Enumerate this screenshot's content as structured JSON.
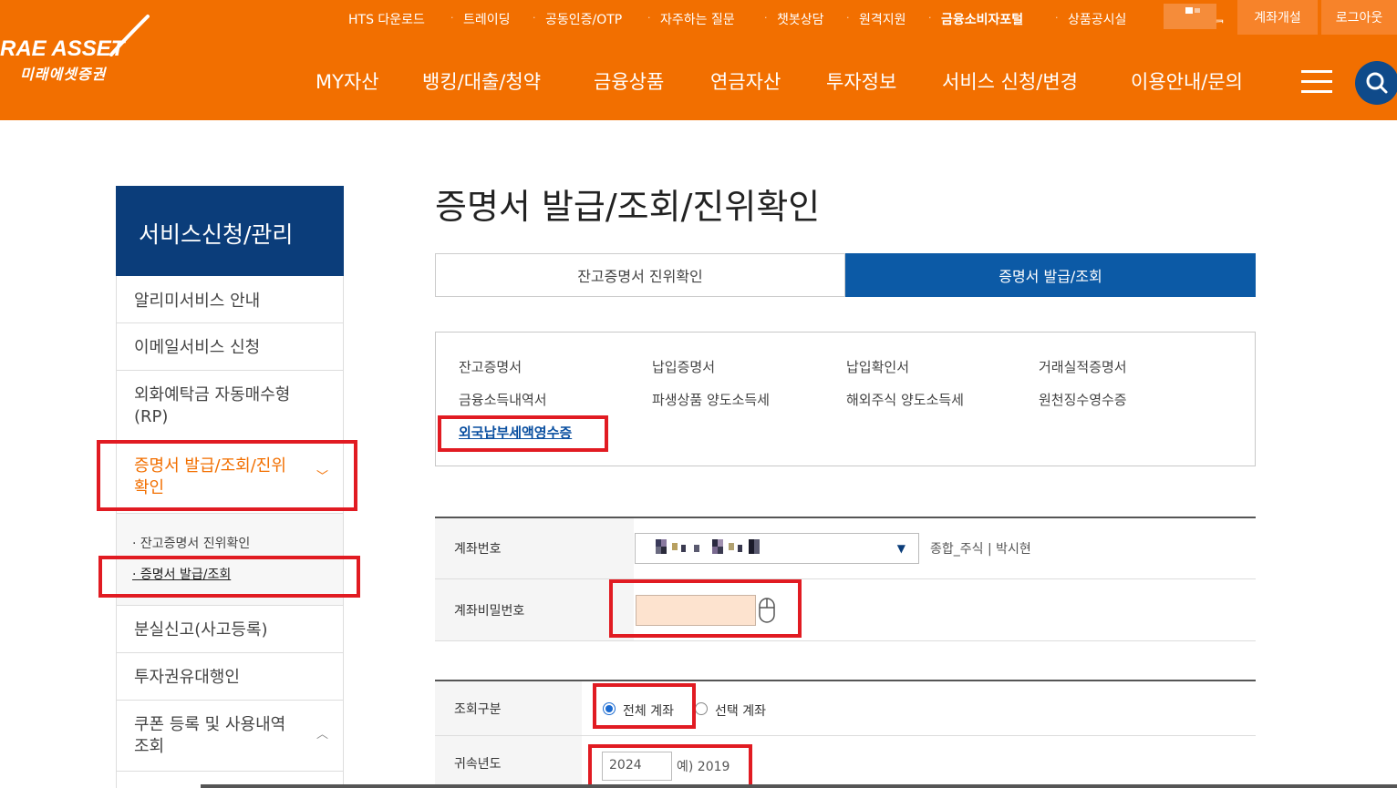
{
  "header": {
    "logo_en": "RAE ASSET",
    "logo_ko": "미래에셋증권",
    "util_links": [
      "HTS 다운로드",
      "트레이딩",
      "공동인증/OTP",
      "자주하는 질문",
      "챗봇상담",
      "원격지원",
      "금융소비자포털",
      "상품공시실"
    ],
    "util_partial": "ᆿ",
    "open_account": "계좌개설",
    "logout": "로그아웃",
    "gnb": [
      "MY자산",
      "뱅킹/대출/청약",
      "금융상품",
      "연금자산",
      "투자정보",
      "서비스 신청/변경",
      "이용안내/문의"
    ],
    "brand_color": "#f26f00"
  },
  "sidebar": {
    "title": "서비스신청/관리",
    "items": [
      {
        "label": "알리미서비스 안내"
      },
      {
        "label": "이메일서비스 신청"
      },
      {
        "label": "외화예탁금 자동매수형 (RP)"
      },
      {
        "label": "증명서 발급/조회/진위 확인",
        "chevron": "﹀"
      },
      {
        "label": "분실신고(사고등록)"
      },
      {
        "label": "투자권유대행인"
      },
      {
        "label": "쿠폰 등록 및 사용내역 조회",
        "chevron": "︿"
      }
    ],
    "subitems": [
      "· 잔고증명서 진위확인",
      "· 증명서 발급/조회"
    ]
  },
  "main": {
    "title": "증명서 발급/조회/진위확인",
    "tabs": [
      "잔고증명서 진위확인",
      "증명서 발급/조회"
    ],
    "docs": [
      "잔고증명서",
      "납입증명서",
      "납입확인서",
      "거래실적증명서",
      "금융소득내역서",
      "파생상품 양도소득세",
      "해외주식 양도소득세",
      "원천징수영수증",
      "외국납부세액영수증"
    ],
    "form": {
      "account_label": "계좌번호",
      "account_type": "종합_주식 | 박시현",
      "password_label": "계좌비밀번호",
      "query_label": "조회구분",
      "radio_all": "전체 계좌",
      "radio_select": "선택 계좌",
      "year_label": "귀속년도",
      "year_value": "2024",
      "year_hint": "예) 2019"
    }
  },
  "colors": {
    "accent": "#f26f00",
    "navy": "#0b3d7a",
    "tab_active": "#0c5aa6",
    "highlight": "#e11b22"
  }
}
